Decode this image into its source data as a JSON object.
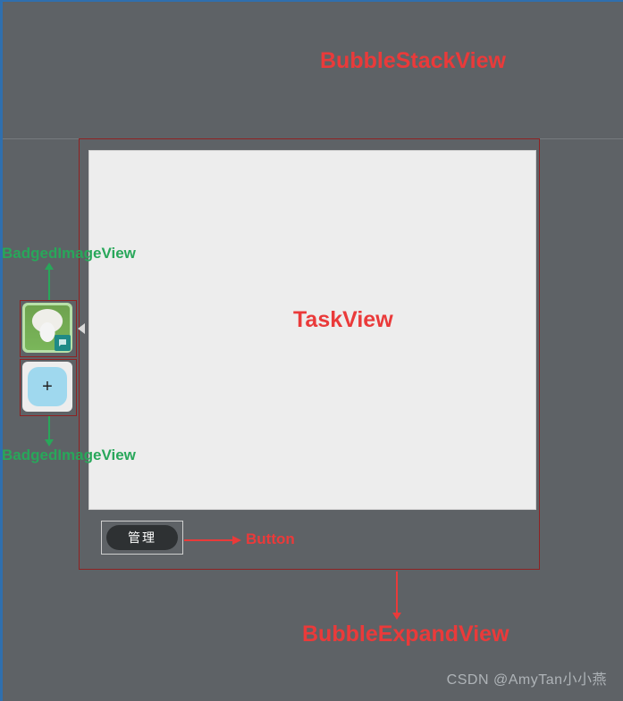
{
  "labels": {
    "bubbleStackView": "BubbleStackView",
    "taskView": "TaskView",
    "bubbleExpandView": "BubbleExpandView",
    "buttonLabel": "Button",
    "badgedImageView": "BadgedImageView"
  },
  "bubbles": {
    "avatar_icon": "sheep-avatar",
    "badge_icon": "chat-badge",
    "add_icon": "+"
  },
  "button": {
    "manage_text": "管理"
  },
  "watermark": "CSDN @AmyTan小小燕",
  "colors": {
    "annotation_red": "#ea3a3a",
    "annotation_green": "#28a75a",
    "background": "#5e6266"
  }
}
